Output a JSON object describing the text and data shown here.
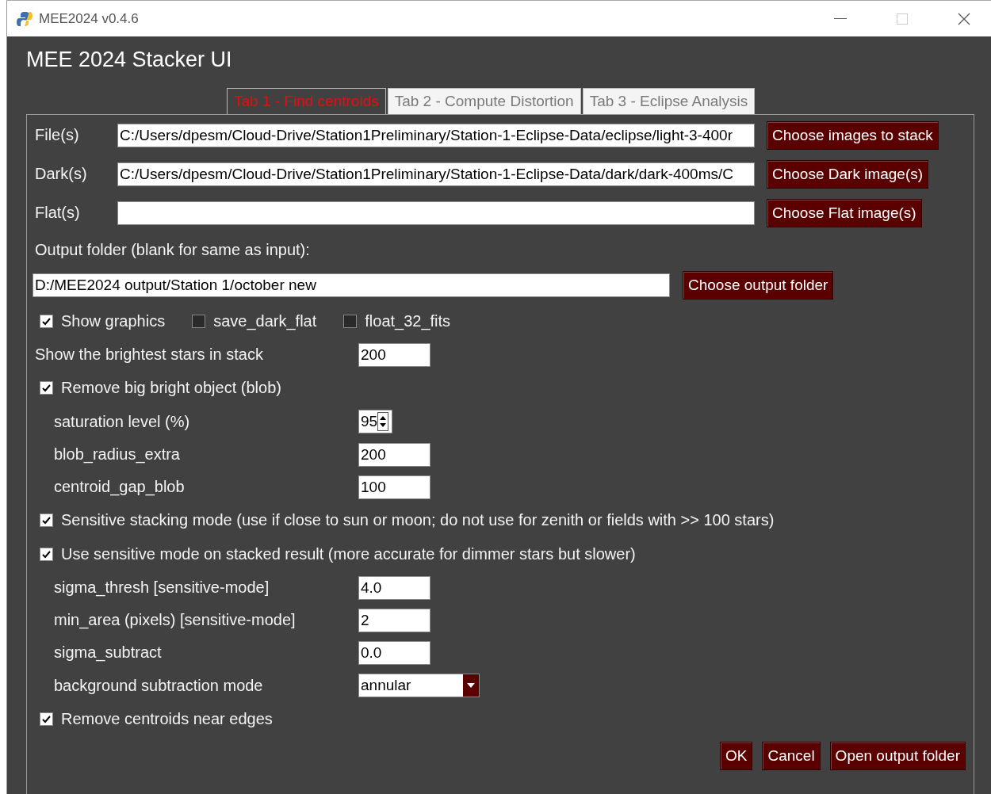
{
  "window": {
    "title": "MEE2024 v0.4.6"
  },
  "heading": "MEE 2024 Stacker UI",
  "tabs": [
    {
      "label": "Tab 1 - Find centroids",
      "selected": true
    },
    {
      "label": "Tab 2 - Compute Distortion",
      "selected": false
    },
    {
      "label": "Tab 3 - Eclipse Analysis",
      "selected": false
    }
  ],
  "rows": [
    {
      "kind": "file",
      "label": "File(s)",
      "value": "C:/Users/dpesm/Cloud-Drive/Station1Preliminary/Station-1-Eclipse-Data/eclipse/light-3-400r",
      "button": "Choose images to stack"
    },
    {
      "kind": "file",
      "label": "Dark(s)",
      "value": "C:/Users/dpesm/Cloud-Drive/Station1Preliminary/Station-1-Eclipse-Data/dark/dark-400ms/C",
      "button": "Choose Dark image(s)"
    },
    {
      "kind": "file",
      "label": "Flat(s)",
      "button": "Choose Flat image(s)"
    },
    {
      "kind": "text",
      "label": "Output folder (blank for same as input):"
    },
    {
      "kind": "folder",
      "value": "D:/MEE2024 output/Station 1/october new",
      "button": "Choose output folder"
    },
    {
      "kind": "checks",
      "checks": [
        {
          "label": "Show graphics",
          "checked": true
        },
        {
          "label": "save_dark_flat",
          "checked": false
        },
        {
          "label": "float_32_fits",
          "checked": false
        }
      ]
    },
    {
      "kind": "number",
      "label": "Show the brightest stars in stack",
      "value": "200",
      "indented": false
    },
    {
      "kind": "checkbox",
      "label": "Remove big bright object (blob)",
      "checked": true
    },
    {
      "kind": "spinner",
      "label": "saturation level (%)",
      "value": "95",
      "indented": true
    },
    {
      "kind": "number",
      "label": "blob_radius_extra",
      "value": "200",
      "indented": true
    },
    {
      "kind": "number",
      "label": "centroid_gap_blob",
      "value": "100",
      "indented": true
    },
    {
      "kind": "checkbox",
      "label": "Sensitive stacking mode (use if close to sun or moon; do not use for zenith or fields with >> 100 stars)",
      "checked": true
    },
    {
      "kind": "checkbox",
      "label": "Use sensitive mode on stacked result (more accurate for dimmer stars but slower)",
      "checked": true
    },
    {
      "kind": "number",
      "label": "sigma_thresh [sensitive-mode]",
      "value": "4.0",
      "indented": true
    },
    {
      "kind": "number",
      "label": "min_area (pixels) [sensitive-mode]",
      "value": "2",
      "indented": true
    },
    {
      "kind": "number",
      "label": "sigma_subtract",
      "value": "0.0",
      "indented": true
    },
    {
      "kind": "dropdown",
      "label": "background subtraction mode",
      "value": "annular",
      "indented": true
    },
    {
      "kind": "checkbox",
      "label": "Remove centroids near edges",
      "checked": true
    }
  ],
  "buttons": [
    "OK",
    "Cancel",
    "Open output folder"
  ]
}
